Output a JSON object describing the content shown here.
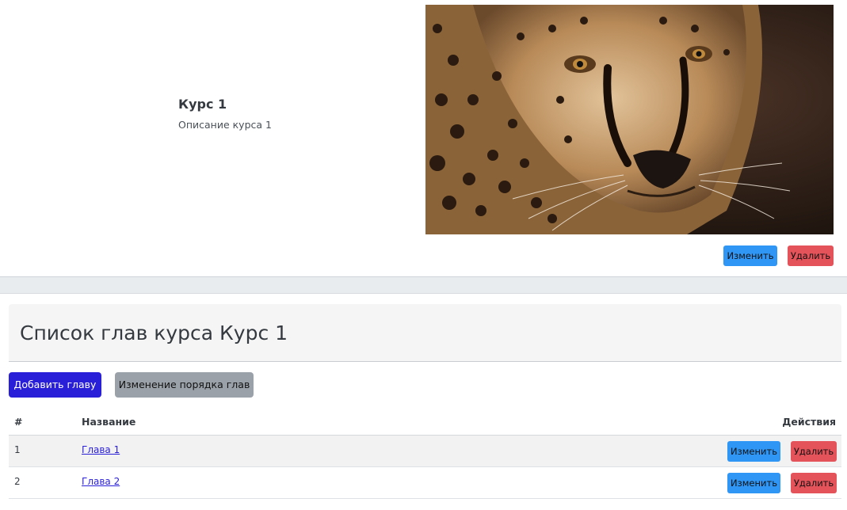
{
  "course": {
    "title": "Курс 1",
    "description": "Описание курса 1",
    "edit_label": "Изменить",
    "delete_label": "Удалить"
  },
  "chapters": {
    "title": "Список глав курса Курс 1",
    "add_label": "Добавить главу",
    "reorder_label": "Изменение порядка глав",
    "columns": {
      "num": "#",
      "name": "Название",
      "actions": "Действия"
    },
    "rows": [
      {
        "num": "1",
        "name": "Глава 1",
        "edit": "Изменить",
        "delete": "Удалить"
      },
      {
        "num": "2",
        "name": "Глава 2",
        "edit": "Изменить",
        "delete": "Удалить"
      }
    ]
  },
  "colors": {
    "primary": "#2a1fd8",
    "info": "#2f96f5",
    "danger": "#e4525a",
    "secondary": "#9aa1a8"
  }
}
